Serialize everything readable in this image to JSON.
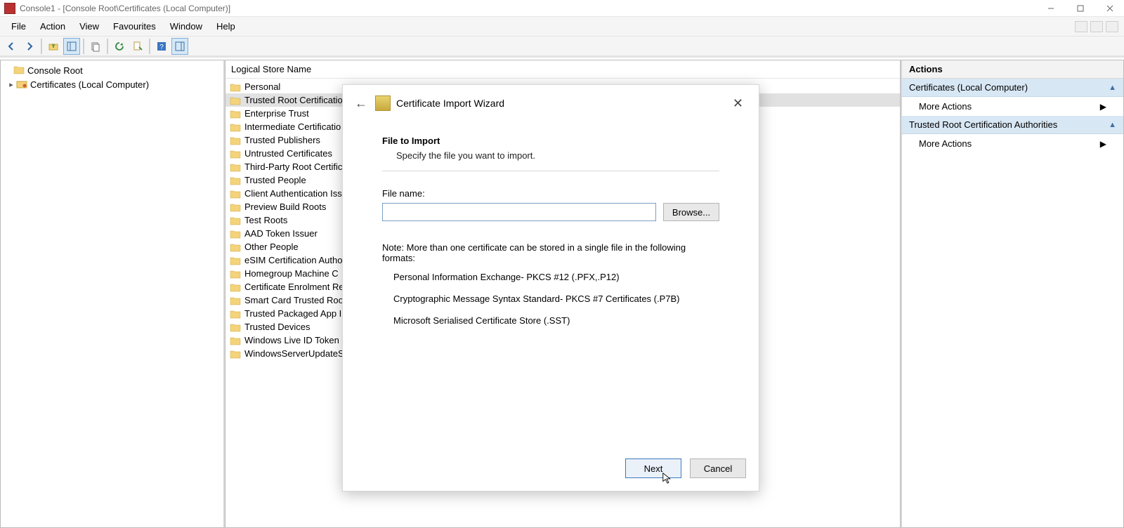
{
  "window": {
    "title": "Console1 - [Console Root\\Certificates (Local Computer)]"
  },
  "menu": {
    "items": [
      "File",
      "Action",
      "View",
      "Favourites",
      "Window",
      "Help"
    ]
  },
  "tree": {
    "root": "Console Root",
    "child": "Certificates (Local Computer)"
  },
  "center": {
    "header": "Logical Store Name",
    "items": [
      "Personal",
      "Trusted Root Certificatio",
      "Enterprise Trust",
      "Intermediate Certificatio",
      "Trusted Publishers",
      "Untrusted Certificates",
      "Third-Party Root Certific",
      "Trusted People",
      "Client Authentication Iss",
      "Preview Build Roots",
      "Test Roots",
      "AAD Token Issuer",
      "Other People",
      "eSIM Certification Autho",
      "Homegroup Machine C",
      "Certificate Enrolment Re",
      "Smart Card Trusted Root",
      "Trusted Packaged App In",
      "Trusted Devices",
      "Windows Live ID Token I",
      "WindowsServerUpdateS"
    ],
    "selected_index": 1
  },
  "right": {
    "title": "Actions",
    "sections": [
      {
        "title": "Certificates (Local Computer)",
        "action": "More Actions"
      },
      {
        "title": "Trusted Root Certification Authorities",
        "action": "More Actions"
      }
    ]
  },
  "dialog": {
    "title": "Certificate Import Wizard",
    "heading": "File to Import",
    "sub": "Specify the file you want to import.",
    "file_label": "File name:",
    "file_value": "",
    "browse": "Browse...",
    "note": "Note:  More than one certificate can be stored in a single file in the following formats:",
    "formats": [
      "Personal Information Exchange- PKCS #12 (.PFX,.P12)",
      "Cryptographic Message Syntax Standard- PKCS #7 Certificates (.P7B)",
      "Microsoft Serialised Certificate Store (.SST)"
    ],
    "next": "Next",
    "cancel": "Cancel"
  }
}
